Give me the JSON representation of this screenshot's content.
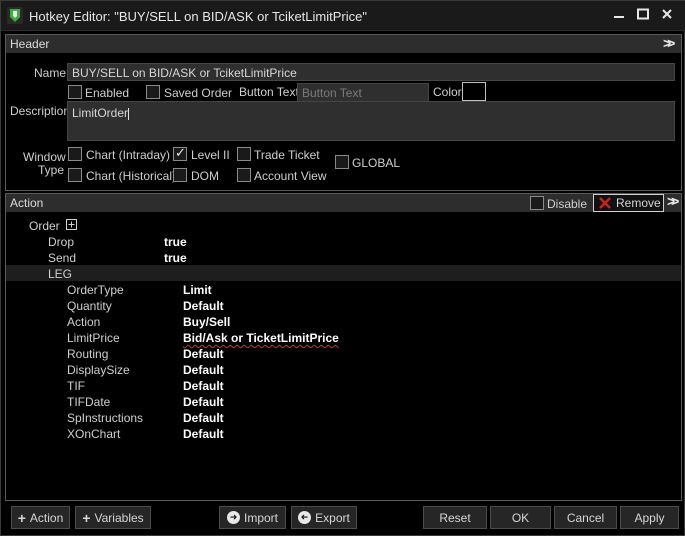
{
  "window": {
    "title": "Hotkey Editor: \"BUY/SELL on BID/ASK or TciketLimitPrice\"",
    "controls": [
      "minimize",
      "maximize",
      "close"
    ]
  },
  "header": {
    "section_title": "Header",
    "name_label": "Name",
    "name_value": "BUY/SELL on BID/ASK or TciketLimitPrice",
    "enabled_label": "Enabled",
    "enabled_checked": false,
    "saved_order_label": "Saved Order",
    "saved_order_checked": false,
    "button_text_label": "Button Text",
    "button_text_placeholder": "Button Text",
    "button_text_value": "",
    "color_label": "Color",
    "color_value": "#000000",
    "description_label": "Description",
    "description_value": "LimitOrder",
    "window_type_label_1": "Window",
    "window_type_label_2": "Type",
    "window_types": [
      {
        "label": "Chart (Intraday)",
        "checked": false
      },
      {
        "label": "Level II",
        "checked": true
      },
      {
        "label": "Trade Ticket",
        "checked": false
      },
      {
        "label": "GLOBAL",
        "checked": false
      },
      {
        "label": "Chart (Historical)",
        "checked": false
      },
      {
        "label": "DOM",
        "checked": false
      },
      {
        "label": "Account View",
        "checked": false
      }
    ]
  },
  "action": {
    "section_title": "Action",
    "disable_label": "Disable",
    "disable_checked": false,
    "remove_label": "Remove",
    "root_label": "Order",
    "root_fields": [
      {
        "key": "Drop",
        "value": "true"
      },
      {
        "key": "Send",
        "value": "true"
      }
    ],
    "leg_label": "LEG",
    "leg_fields": [
      {
        "key": "OrderType",
        "value": "Limit"
      },
      {
        "key": "Quantity",
        "value": "Default"
      },
      {
        "key": "Action",
        "value": "Buy/Sell"
      },
      {
        "key": "LimitPrice",
        "value": "Bid/Ask or TicketLimitPrice"
      },
      {
        "key": "Routing",
        "value": "Default"
      },
      {
        "key": "DisplaySize",
        "value": "Default"
      },
      {
        "key": "TIF",
        "value": "Default"
      },
      {
        "key": "TIFDate",
        "value": "Default"
      },
      {
        "key": "SpInstructions",
        "value": "Default"
      },
      {
        "key": "XOnChart",
        "value": "Default"
      }
    ]
  },
  "footer": {
    "add_action_label": "Action",
    "add_variables_label": "Variables",
    "import_label": "Import",
    "export_label": "Export",
    "reset_label": "Reset",
    "ok_label": "OK",
    "cancel_label": "Cancel",
    "apply_label": "Apply"
  },
  "colors": {
    "background": "#000000",
    "section_bar": "#2d2d2d",
    "remove_icon": "#d02020",
    "app_icon_green": "#3cae3c"
  }
}
